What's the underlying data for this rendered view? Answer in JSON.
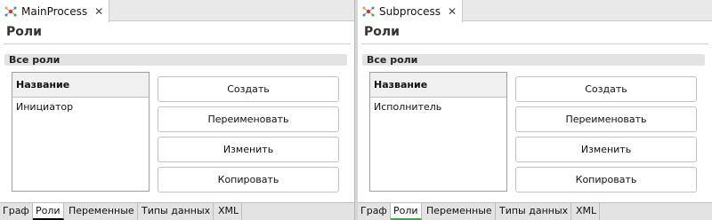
{
  "left_editor": {
    "tab_title": "MainProcess",
    "section_title": "Роли",
    "group_label": "Все роли",
    "table": {
      "column_header": "Название",
      "rows": [
        "Инициатор"
      ]
    },
    "buttons": [
      "Создать",
      "Переименовать",
      "Изменить",
      "Копировать"
    ],
    "bottom_tabs": [
      "Граф",
      "Роли",
      "Переменные",
      "Типы данных",
      "XML"
    ],
    "active_bottom_tab": "Роли",
    "active_tab_underline_color": "#000000"
  },
  "right_editor": {
    "tab_title": "Subprocess",
    "section_title": "Роли",
    "group_label": "Все роли",
    "table": {
      "column_header": "Название",
      "rows": [
        "Исполнитель"
      ]
    },
    "buttons": [
      "Создать",
      "Переименовать",
      "Изменить",
      "Копировать"
    ],
    "bottom_tabs": [
      "Граф",
      "Роли",
      "Переменные",
      "Типы данных",
      "XML"
    ],
    "active_bottom_tab": "Роли",
    "active_tab_underline_color": "#3fa64a"
  },
  "icons": {
    "process_icon": "process-diagram-icon",
    "close_icon": "close-icon"
  }
}
